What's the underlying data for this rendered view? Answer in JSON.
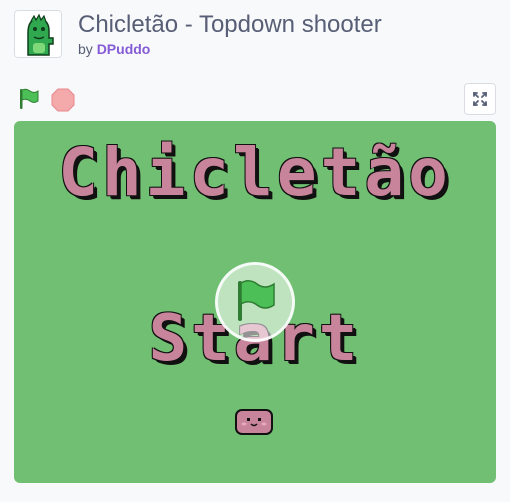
{
  "project": {
    "title": "Chicletão - Topdown shooter",
    "by_prefix": "by",
    "author": "DPuddo",
    "avatar_icon": "green-dinosaur-icon"
  },
  "controls": {
    "green_flag_icon": "green-flag-icon",
    "stop_icon": "stop-sign-icon",
    "fullscreen_icon": "fullscreen-icon"
  },
  "stage": {
    "background_color": "#71bf72",
    "game_title": "Chicletão",
    "start_label": "Start",
    "play_overlay_icon": "green-flag-icon",
    "sprite_icon": "pink-gum-character-icon"
  }
}
